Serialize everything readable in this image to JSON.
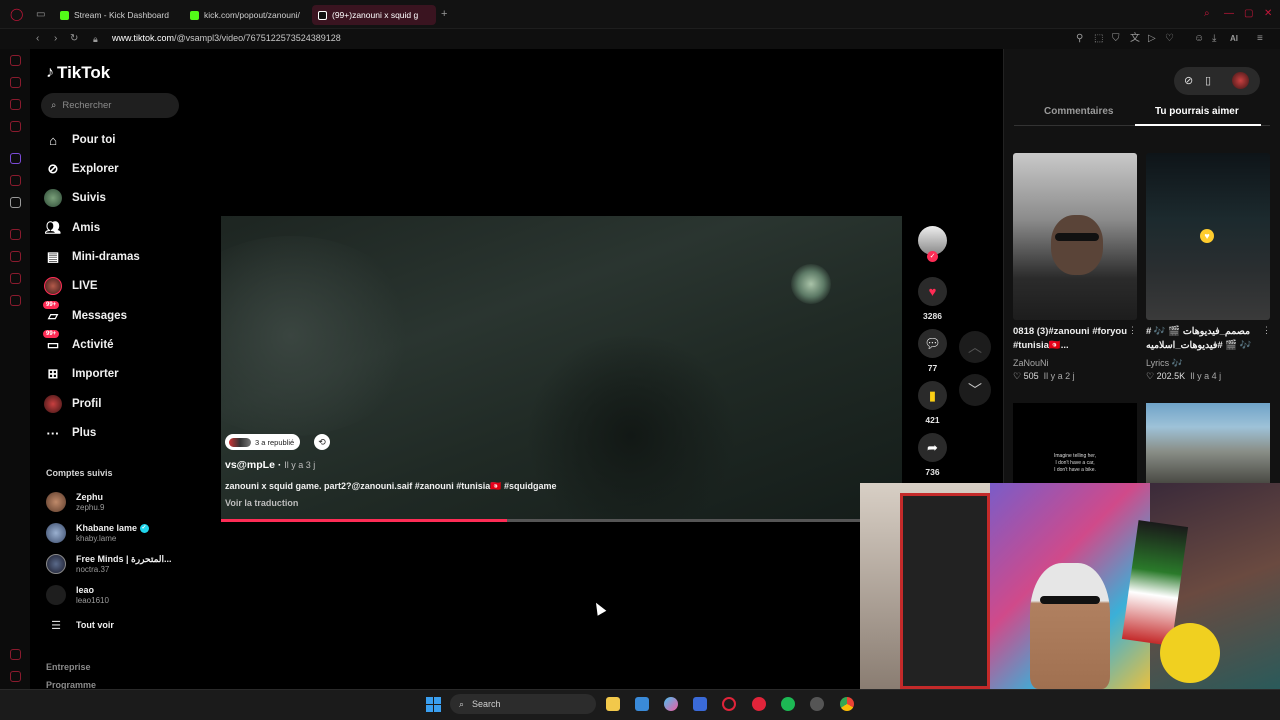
{
  "browser": {
    "tabs": [
      {
        "title": "Stream - Kick Dashboard",
        "favicon": "kick-icon"
      },
      {
        "title": "kick.com/popout/zanouni/",
        "favicon": "kick-icon"
      },
      {
        "title": "(99+)zanouni x squid g",
        "favicon": "tiktok-icon",
        "active": true
      }
    ],
    "url_host": "www.tiktok.com",
    "url_path": "/@vsampl3/video/7675122573524389128",
    "ai_label": "AI"
  },
  "tiktok": {
    "logo": "TikTok",
    "search_placeholder": "Rechercher",
    "nav": [
      {
        "label": "Pour toi",
        "icon": "home-icon"
      },
      {
        "label": "Explorer",
        "icon": "compass-icon"
      },
      {
        "label": "Suivis",
        "icon": "following-avatar-icon"
      },
      {
        "label": "Amis",
        "icon": "friends-icon"
      },
      {
        "label": "Mini-dramas",
        "icon": "film-icon"
      },
      {
        "label": "LIVE",
        "icon": "live-avatar-icon"
      },
      {
        "label": "Messages",
        "icon": "message-icon",
        "badge": "99+"
      },
      {
        "label": "Activité",
        "icon": "activity-icon",
        "badge": "99+"
      },
      {
        "label": "Importer",
        "icon": "upload-icon"
      },
      {
        "label": "Profil",
        "icon": "profile-avatar-icon"
      },
      {
        "label": "Plus",
        "icon": "more-icon"
      }
    ],
    "followed_title": "Comptes suivis",
    "followed": [
      {
        "name": "Zephu",
        "handle": "zephu.9",
        "color": "#8a5a3a"
      },
      {
        "name": "Khabane lame",
        "handle": "khaby.lame",
        "verified": true,
        "color": "#4a6a9a"
      },
      {
        "name": "Free Minds | المتحررة...",
        "handle": "noctra.37",
        "color": "#2a2a40"
      },
      {
        "name": "leao",
        "handle": "leao1610",
        "color": "#1e1e1e"
      }
    ],
    "see_all": "Tout voir",
    "footer": [
      "Entreprise",
      "Programme"
    ]
  },
  "video": {
    "repost_text": "3 a republié",
    "author": "vs@mpLe",
    "time": "Il y a 3 j",
    "caption": "zanouni x squid game. part2?@zanouni.saif #zanouni #tunisia🇹🇳 #squidgame",
    "translate": "Voir la traduction",
    "progress": 0.42,
    "likes": "3286",
    "comments": "77",
    "saves": "421",
    "shares": "736"
  },
  "panel": {
    "tab_comments": "Commentaires",
    "tab_suggestions": "Tu pourrais aimer",
    "cards": [
      {
        "title": "0818 (3)#zanouni #foryou #tunisia🇹🇳...",
        "author": "ZaNouNi",
        "likes": "505",
        "time": "Il y a 2 j"
      },
      {
        "title": "# 🎶 🎬 مصمم_فيديوهات #فيديوهات_اسلاميه 🎬 🎶",
        "author": "Lyrics 🎶",
        "likes": "202.5K",
        "time": "Il y a 4 j"
      }
    ],
    "thumb3_text": [
      "Imagine telling her,",
      "I don't have a car,",
      "I don't have a bike."
    ]
  },
  "taskbar": {
    "search": "Search"
  },
  "colors": {
    "accent": "#fe2c55",
    "opera_red": "#8a1b2e",
    "bg": "#000000"
  }
}
